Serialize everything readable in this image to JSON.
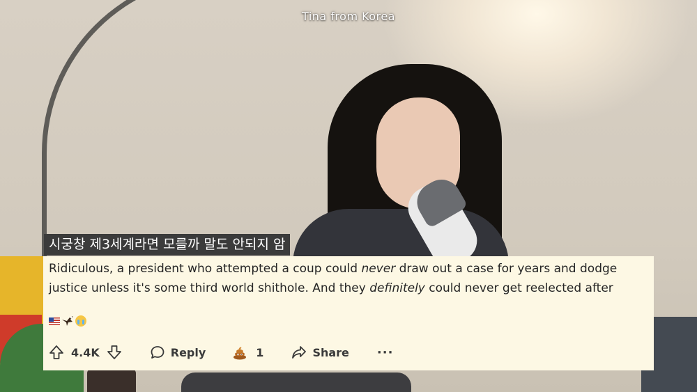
{
  "video": {
    "channel_tag": "Tina from Korea",
    "korean_caption": "시궁창 제3세계라면 모를까 말도 안되지 암"
  },
  "comment": {
    "line1": {
      "before": "Ridiculous, a president who attempted a coup could ",
      "italic": "never",
      "after": " draw out a case for years and dodge"
    },
    "line2": {
      "before": "justice unless it's some third world shithole. And they ",
      "italic": "definitely",
      "after": " could never get reelected after"
    },
    "emojis": [
      "us-flag-emoji",
      "eagle-emoji",
      "loudly-crying-face-emoji"
    ]
  },
  "actions": {
    "upvote_icon": "upvote-arrow-icon",
    "vote_count": "4.4K",
    "downvote_icon": "downvote-arrow-icon",
    "reply_icon": "speech-bubble-icon",
    "reply_label": "Reply",
    "award_icon": "poop-award-icon",
    "award_count": "1",
    "share_icon": "share-arrow-icon",
    "share_label": "Share",
    "more_label": "···"
  },
  "colors": {
    "card_background": "#fdf8e4",
    "caption_background": "#3b3b3b",
    "text": "#262626"
  }
}
